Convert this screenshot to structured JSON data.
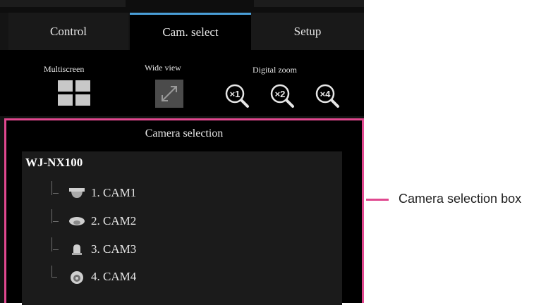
{
  "tabs": [
    {
      "label": "Control",
      "active": false
    },
    {
      "label": "Cam. select",
      "active": true
    },
    {
      "label": "Setup",
      "active": false
    }
  ],
  "toolbar": {
    "multiscreen_label": "Multiscreen",
    "wide_view_label": "Wide view",
    "digital_zoom_label": "Digital zoom",
    "zoom_levels": [
      "×1",
      "×2",
      "×4"
    ]
  },
  "camera_selection": {
    "title": "Camera selection",
    "recorder": "WJ-NX100",
    "cameras": [
      {
        "label": "1. CAM1",
        "icon": "dome-camera-icon"
      },
      {
        "label": "2. CAM2",
        "icon": "flat-dome-camera-icon"
      },
      {
        "label": "3. CAM3",
        "icon": "compact-camera-icon"
      },
      {
        "label": "4. CAM4",
        "icon": "fisheye-camera-icon"
      }
    ]
  },
  "callout": {
    "label": "Camera selection box"
  },
  "colors": {
    "accent": "#e0488f",
    "active_tab": "#4a9fd8",
    "panel": "#000000"
  }
}
